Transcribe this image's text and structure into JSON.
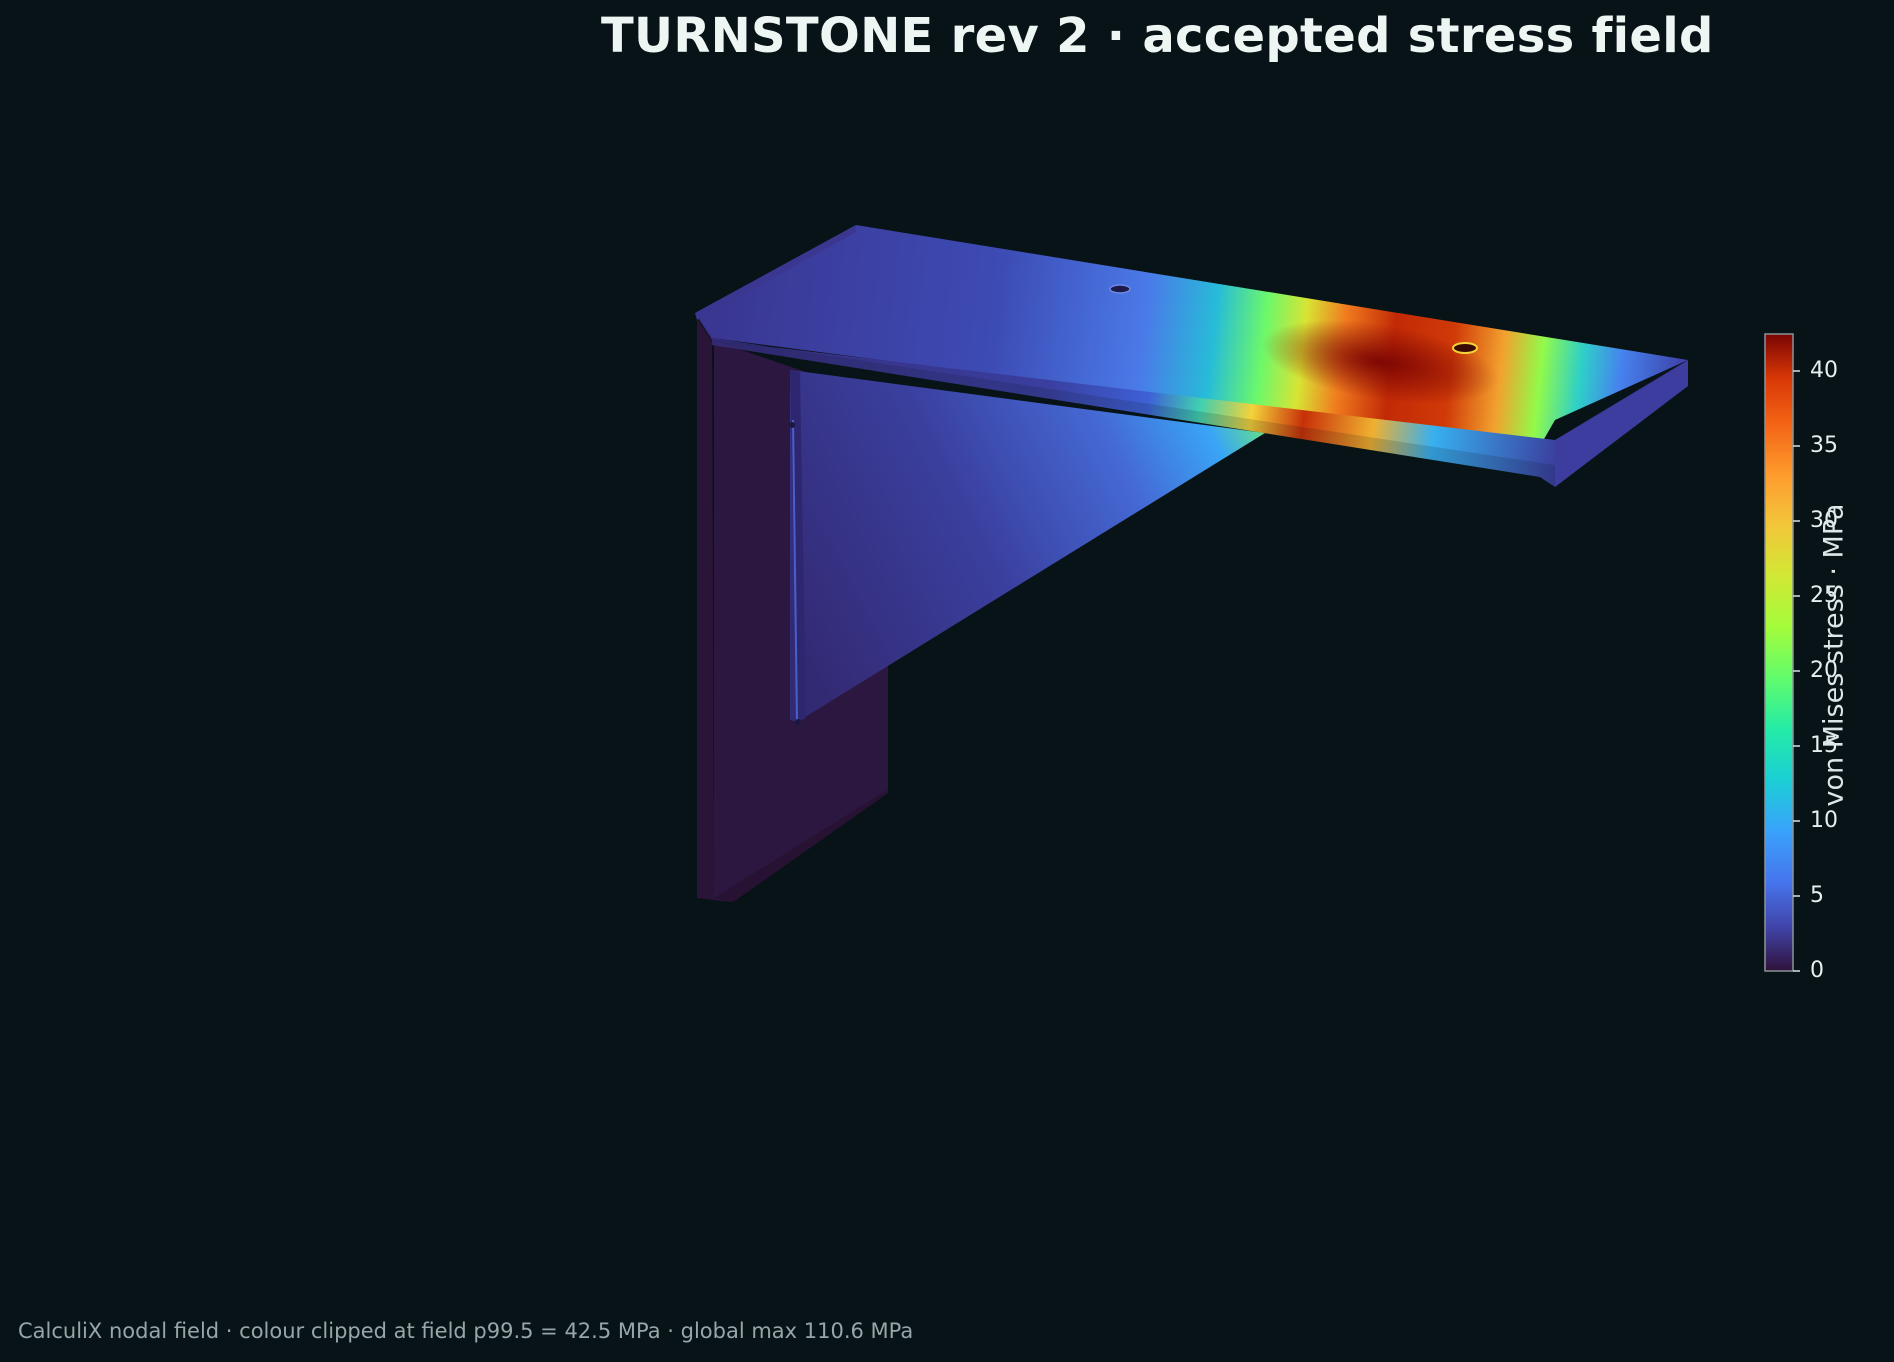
{
  "title": "TURNSTONE rev 2 · accepted stress field",
  "footnote": "CalculiX nodal field · colour clipped at field p99.5 = 42.5 MPa · global max 110.6 MPa",
  "colorbar": {
    "label": "von Mises stress · MPa",
    "min": 0,
    "max": 42.5,
    "ticks": [
      "0",
      "5",
      "10",
      "15",
      "20",
      "25",
      "30",
      "35",
      "40"
    ],
    "colormap": "turbo"
  },
  "colors": {
    "background": "#081317",
    "text": "#eef6f4",
    "muted": "#97a6a8",
    "low_stress": "#2e1840",
    "high_stress": "#7a0403"
  }
}
